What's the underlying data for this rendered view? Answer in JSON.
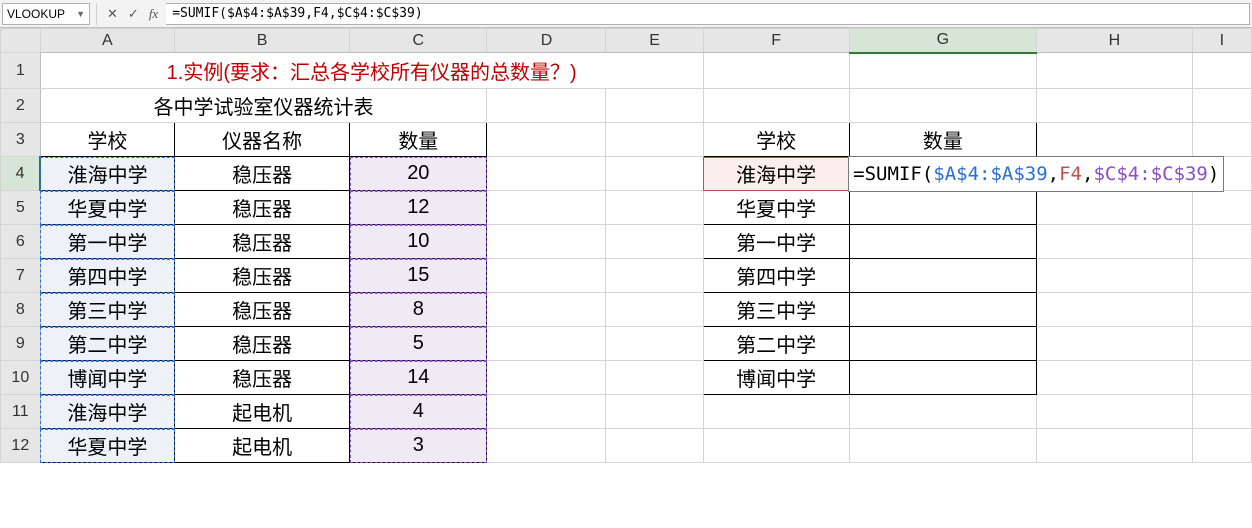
{
  "formulaBar": {
    "nameBox": "VLOOKUP",
    "cancel": "✕",
    "confirm": "✓",
    "fx": "fx",
    "formula": "=SUMIF($A$4:$A$39,F4,$C$4:$C$39)"
  },
  "columns": [
    "A",
    "B",
    "C",
    "D",
    "E",
    "F",
    "G",
    "H",
    "I"
  ],
  "rows": [
    "1",
    "2",
    "3",
    "4",
    "5",
    "6",
    "7",
    "8",
    "9",
    "10",
    "11",
    "12"
  ],
  "title": "1.实例(要求：汇总各学校所有仪器的总数量？)",
  "subtitle": "各中学试验室仪器统计表",
  "leftHeaders": {
    "school": "学校",
    "device": "仪器名称",
    "count": "数量"
  },
  "leftData": [
    {
      "school": "淮海中学",
      "device": "稳压器",
      "count": "20"
    },
    {
      "school": "华夏中学",
      "device": "稳压器",
      "count": "12"
    },
    {
      "school": "第一中学",
      "device": "稳压器",
      "count": "10"
    },
    {
      "school": "第四中学",
      "device": "稳压器",
      "count": "15"
    },
    {
      "school": "第三中学",
      "device": "稳压器",
      "count": "8"
    },
    {
      "school": "第二中学",
      "device": "稳压器",
      "count": "5"
    },
    {
      "school": "博闻中学",
      "device": "稳压器",
      "count": "14"
    },
    {
      "school": "淮海中学",
      "device": "起电机",
      "count": "4"
    },
    {
      "school": "华夏中学",
      "device": "起电机",
      "count": "3"
    }
  ],
  "rightHeaders": {
    "school": "学校",
    "count": "数量"
  },
  "rightData": [
    "淮海中学",
    "华夏中学",
    "第一中学",
    "第四中学",
    "第三中学",
    "第二中学",
    "博闻中学"
  ],
  "editingFormula": {
    "eq": "=",
    "fn": "SUMIF",
    "open": "(",
    "arg1": "$A$4:$A$39",
    "c1": ",",
    "arg2": "F4",
    "c2": ",",
    "arg3": "$C$4:$C$39",
    "close": ")"
  }
}
